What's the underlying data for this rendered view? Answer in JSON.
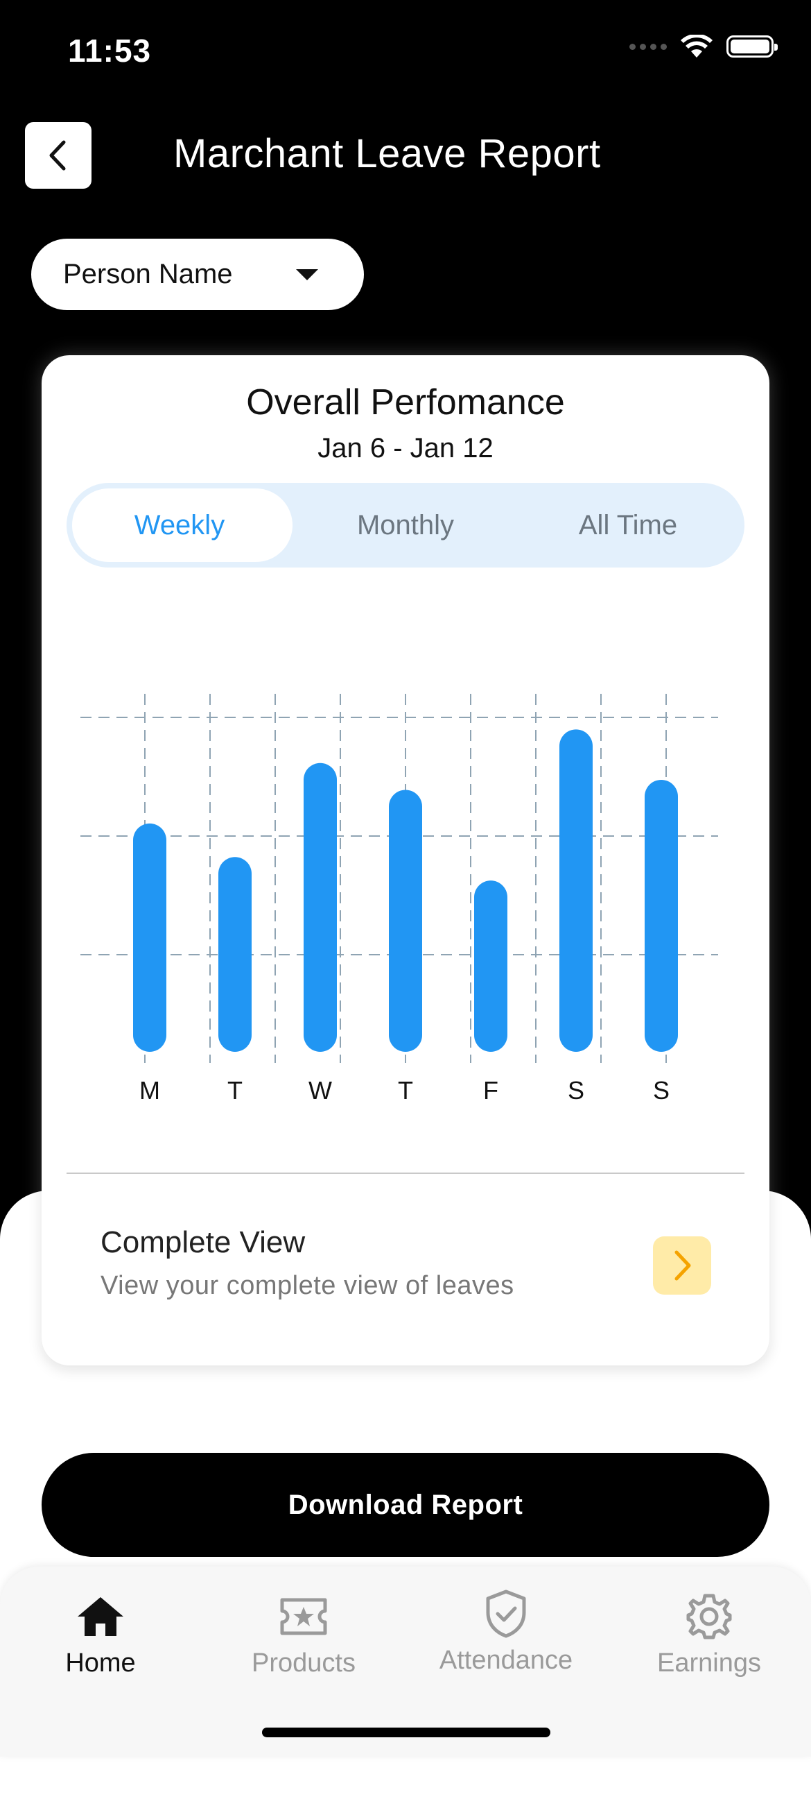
{
  "status_bar": {
    "time": "11:53"
  },
  "header": {
    "title": "Marchant Leave Report",
    "back_icon": "chevron-left-icon"
  },
  "filter": {
    "person_label": "Person Name"
  },
  "card": {
    "title": "Overall Perfomance",
    "date_range": "Jan 6 - Jan 12",
    "tabs": [
      {
        "label": "Weekly",
        "active": true
      },
      {
        "label": "Monthly",
        "active": false
      },
      {
        "label": "All Time",
        "active": false
      }
    ],
    "complete_view": {
      "title": "Complete View",
      "subtitle": "View your complete view of leaves"
    }
  },
  "chart_data": {
    "type": "bar",
    "categories": [
      "M",
      "T",
      "W",
      "T",
      "F",
      "S",
      "S"
    ],
    "values": [
      68,
      58,
      86,
      78,
      51,
      96,
      81
    ],
    "ylim": [
      0,
      100
    ],
    "grid": true,
    "colors": {
      "bar": "#2196F3",
      "grid": "#8FA4B3"
    }
  },
  "actions": {
    "download_label": "Download Report"
  },
  "tab_bar": {
    "items": [
      {
        "label": "Home",
        "icon": "home-icon",
        "active": true
      },
      {
        "label": "Products",
        "icon": "ticket-star-icon",
        "active": false
      },
      {
        "label": "Attendance",
        "icon": "shield-check-icon",
        "active": false
      },
      {
        "label": "Earnings",
        "icon": "gear-icon",
        "active": false
      }
    ]
  },
  "colors": {
    "accent": "#2196F3",
    "segment_bg": "#E3F0FC",
    "arrow_bg": "#FFEBA8",
    "arrow": "#F5A300"
  }
}
